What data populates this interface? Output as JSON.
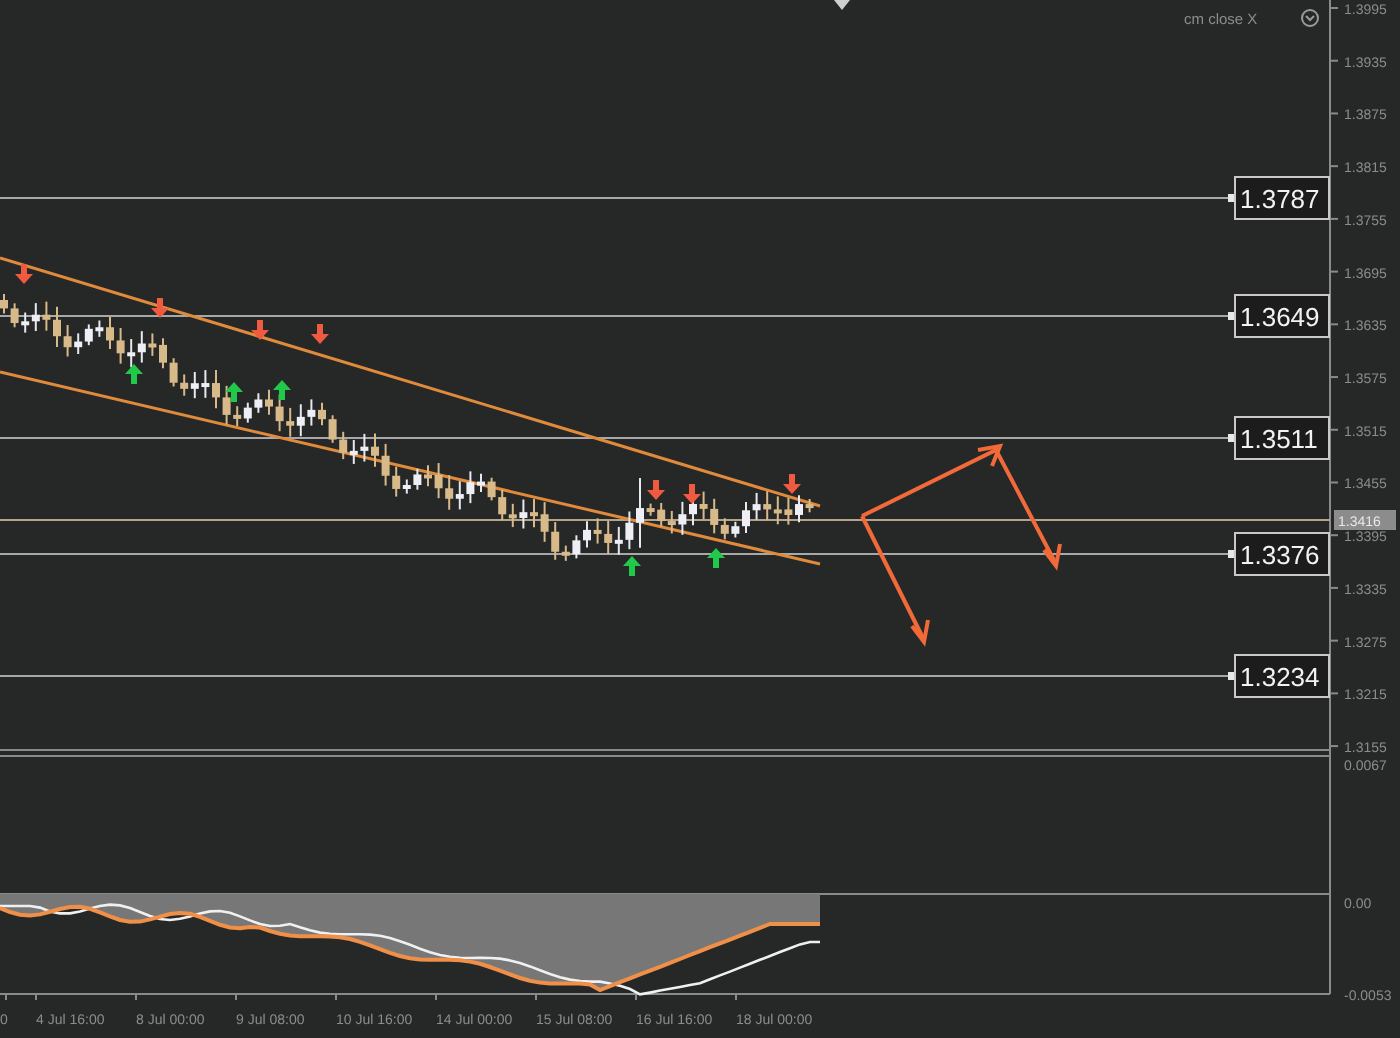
{
  "chart": {
    "close_label": "cm close X",
    "price_axis": [
      "1.3995",
      "1.3935",
      "1.3875",
      "1.3815",
      "1.3755",
      "1.3695",
      "1.3635",
      "1.3575",
      "1.3515",
      "1.3455",
      "1.3395",
      "1.3335",
      "1.3275",
      "1.3215",
      "1.3155"
    ],
    "current_price": "1.3416",
    "levels": [
      {
        "label": "1.3787"
      },
      {
        "label": "1.3649"
      },
      {
        "label": "1.3511"
      },
      {
        "label": "1.3376"
      },
      {
        "label": "1.3234"
      }
    ]
  },
  "indicator": {
    "axis": [
      "0.0067",
      "0.00",
      "-0.0053"
    ]
  },
  "time_axis": [
    "0",
    "4 Jul 16:00",
    "8 Jul 00:00",
    "9 Jul 08:00",
    "10 Jul 16:00",
    "14 Jul 00:00",
    "15 Jul 08:00",
    "16 Jul 16:00",
    "18 Jul 00:00"
  ]
}
